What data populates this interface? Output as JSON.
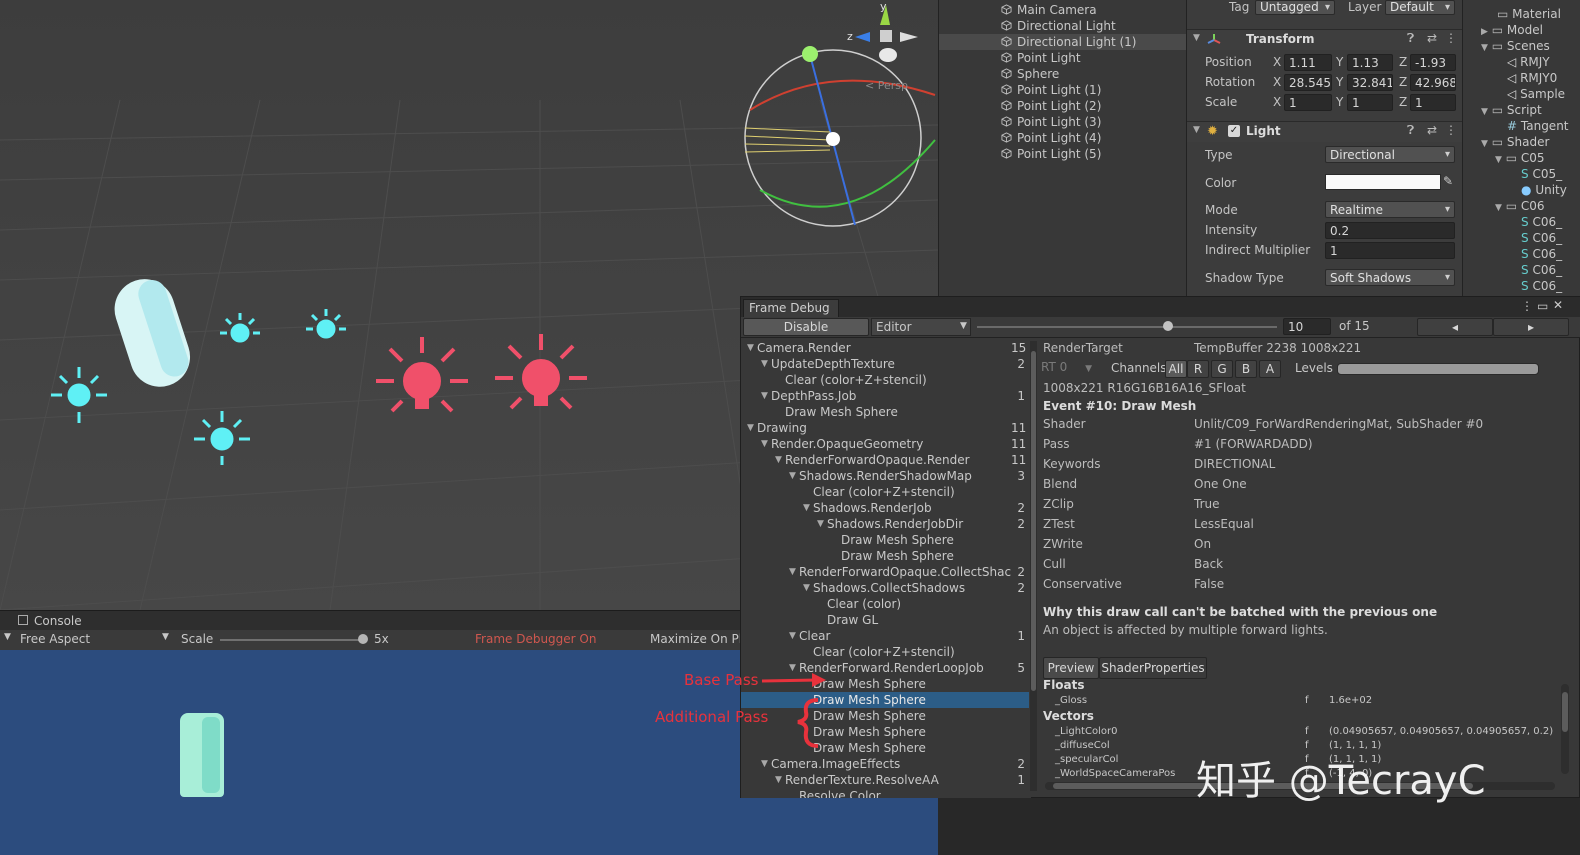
{
  "scene": {
    "persp_label": "< Persp",
    "gizmo_axes": [
      "y",
      "z"
    ]
  },
  "console": {
    "tab_label": "Console"
  },
  "game_toolbar": {
    "aspect": "Free Aspect",
    "scale_label": "Scale",
    "scale_value": "5x",
    "frame_debugger_status": "Frame Debugger On",
    "maximize": "Maximize On Pla"
  },
  "hierarchy": {
    "items": [
      "Main Camera",
      "Directional Light",
      "Directional Light (1)",
      "Point Light",
      "Sphere",
      "Point Light (1)",
      "Point Light (2)",
      "Point Light (3)",
      "Point Light (4)",
      "Point Light (5)"
    ],
    "selected_index": 2
  },
  "inspector": {
    "tag_label": "Tag",
    "tag_value": "Untagged",
    "layer_label": "Layer",
    "layer_value": "Default",
    "transform": {
      "title": "Transform",
      "position_label": "Position",
      "position": {
        "x": "1.11",
        "y": "1.13",
        "z": "-1.93"
      },
      "rotation_label": "Rotation",
      "rotation": {
        "x": "28.545",
        "y": "32.841",
        "z": "42.968"
      },
      "scale_label": "Scale",
      "scale": {
        "x": "1",
        "y": "1",
        "z": "1"
      },
      "axis_x": "X",
      "axis_y": "Y",
      "axis_z": "Z"
    },
    "light": {
      "title": "Light",
      "type_label": "Type",
      "type_value": "Directional",
      "color_label": "Color",
      "mode_label": "Mode",
      "mode_value": "Realtime",
      "intensity_label": "Intensity",
      "intensity_value": "0.2",
      "indirect_label": "Indirect Multiplier",
      "indirect_value": "1",
      "shadow_label": "Shadow Type",
      "shadow_value": "Soft Shadows"
    }
  },
  "project": {
    "items": [
      {
        "label": "Material",
        "kind": "folder"
      },
      {
        "label": "Model",
        "kind": "folder"
      },
      {
        "label": "Scenes",
        "kind": "folder"
      },
      {
        "label": "RMJY",
        "kind": "unity"
      },
      {
        "label": "RMJY0",
        "kind": "unity"
      },
      {
        "label": "Sample",
        "kind": "unity"
      },
      {
        "label": "Script",
        "kind": "folder"
      },
      {
        "label": "Tangent",
        "kind": "script"
      },
      {
        "label": "Shader",
        "kind": "folder"
      },
      {
        "label": "C05",
        "kind": "folder"
      },
      {
        "label": "C05_",
        "kind": "shader"
      },
      {
        "label": "Unity",
        "kind": "sphere"
      },
      {
        "label": "C06",
        "kind": "folder"
      },
      {
        "label": "C06_",
        "kind": "shader"
      },
      {
        "label": "C06_",
        "kind": "shader"
      },
      {
        "label": "C06_",
        "kind": "shader"
      },
      {
        "label": "C06_",
        "kind": "shader"
      },
      {
        "label": "C06_",
        "kind": "shader"
      }
    ]
  },
  "frame_debug": {
    "tab": "Frame Debug",
    "disable_button": "Disable",
    "target_select": "Editor",
    "current_event": "10",
    "of_total": "of 15",
    "prev_label": "◂",
    "next_label": "▸",
    "tree": [
      {
        "label": "Camera.Render",
        "depth": 0,
        "count": "15",
        "expanded": true
      },
      {
        "label": "UpdateDepthTexture",
        "depth": 1,
        "count": "2",
        "expanded": true
      },
      {
        "label": "Clear (color+Z+stencil)",
        "depth": 2,
        "count": ""
      },
      {
        "label": "DepthPass.Job",
        "depth": 1,
        "count": "1",
        "expanded": true
      },
      {
        "label": "Draw Mesh Sphere",
        "depth": 2,
        "count": ""
      },
      {
        "label": "Drawing",
        "depth": 0,
        "count": "11",
        "expanded": true
      },
      {
        "label": "Render.OpaqueGeometry",
        "depth": 1,
        "count": "11",
        "expanded": true
      },
      {
        "label": "RenderForwardOpaque.Render",
        "depth": 2,
        "count": "11",
        "expanded": true
      },
      {
        "label": "Shadows.RenderShadowMap",
        "depth": 3,
        "count": "3",
        "expanded": true
      },
      {
        "label": "Clear (color+Z+stencil)",
        "depth": 4,
        "count": ""
      },
      {
        "label": "Shadows.RenderJob",
        "depth": 4,
        "count": "2",
        "expanded": true
      },
      {
        "label": "Shadows.RenderJobDir",
        "depth": 5,
        "count": "2",
        "expanded": true
      },
      {
        "label": "Draw Mesh Sphere",
        "depth": 6,
        "count": ""
      },
      {
        "label": "Draw Mesh Sphere",
        "depth": 6,
        "count": ""
      },
      {
        "label": "RenderForwardOpaque.CollectShac",
        "depth": 3,
        "count": "2",
        "expanded": true
      },
      {
        "label": "Shadows.CollectShadows",
        "depth": 4,
        "count": "2",
        "expanded": true
      },
      {
        "label": "Clear (color)",
        "depth": 5,
        "count": ""
      },
      {
        "label": "Draw GL",
        "depth": 5,
        "count": ""
      },
      {
        "label": "Clear",
        "depth": 3,
        "count": "1",
        "expanded": true
      },
      {
        "label": "Clear (color+Z+stencil)",
        "depth": 4,
        "count": ""
      },
      {
        "label": "RenderForward.RenderLoopJob",
        "depth": 3,
        "count": "5",
        "expanded": true
      },
      {
        "label": "Draw Mesh Sphere",
        "depth": 4,
        "count": ""
      },
      {
        "label": "Draw Mesh Sphere",
        "depth": 4,
        "count": "",
        "selected": true
      },
      {
        "label": "Draw Mesh Sphere",
        "depth": 4,
        "count": ""
      },
      {
        "label": "Draw Mesh Sphere",
        "depth": 4,
        "count": ""
      },
      {
        "label": "Draw Mesh Sphere",
        "depth": 4,
        "count": ""
      },
      {
        "label": "Camera.ImageEffects",
        "depth": 1,
        "count": "2",
        "expanded": true
      },
      {
        "label": "RenderTexture.ResolveAA",
        "depth": 2,
        "count": "1",
        "expanded": true
      },
      {
        "label": "Resolve Color",
        "depth": 3,
        "count": ""
      }
    ],
    "render_target_label": "RenderTarget",
    "render_target_value": "TempBuffer 2238 1008x221",
    "rt_select": "RT 0",
    "channels_label": "Channels",
    "channels": [
      "All",
      "R",
      "G",
      "B",
      "A"
    ],
    "levels_label": "Levels",
    "format": "1008x221 R16G16B16A16_SFloat",
    "event_title": "Event #10: Draw Mesh",
    "props": [
      {
        "k": "Shader",
        "v": "Unlit/C09_ForWardRenderingMat, SubShader #0"
      },
      {
        "k": "Pass",
        "v": "#1 (FORWARDADD)"
      },
      {
        "k": "Keywords",
        "v": "DIRECTIONAL"
      },
      {
        "k": "Blend",
        "v": "One One"
      },
      {
        "k": "ZClip",
        "v": "True"
      },
      {
        "k": "ZTest",
        "v": "LessEqual"
      },
      {
        "k": "ZWrite",
        "v": "On"
      },
      {
        "k": "Cull",
        "v": "Back"
      },
      {
        "k": "Conservative",
        "v": "False"
      }
    ],
    "batch_title": "Why this draw call can't be batched with the previous one",
    "batch_reason": "An object is affected by multiple forward lights.",
    "tabs": [
      "Preview",
      "ShaderProperties"
    ],
    "floats_label": "Floats",
    "floats": [
      {
        "name": "_Gloss",
        "type": "f",
        "value": "1.6e+02"
      }
    ],
    "vectors_label": "Vectors",
    "vectors": [
      {
        "name": "_LightColor0",
        "type": "f",
        "value": "(0.04905657, 0.04905657, 0.04905657, 0.2)"
      },
      {
        "name": "_diffuseCol",
        "type": "f",
        "value": "(1, 1, 1, 1)"
      },
      {
        "name": "_specularCol",
        "type": "f",
        "value": "(1, 1, 1, 1)"
      },
      {
        "name": "_WorldSpaceCameraPos",
        "type": "f",
        "value": "(-1, 4, 0)"
      }
    ]
  },
  "annotations": {
    "base_pass": "Base Pass",
    "additional_pass": "Additional Pass",
    "color": "#e8323c"
  },
  "watermark": "知乎 @TecrayC",
  "colors": {
    "selection": "#2c5d87",
    "frame_debugger_on": "#d0574f",
    "light_cyan": "#5ff0f5",
    "light_red": "#f0506a"
  }
}
